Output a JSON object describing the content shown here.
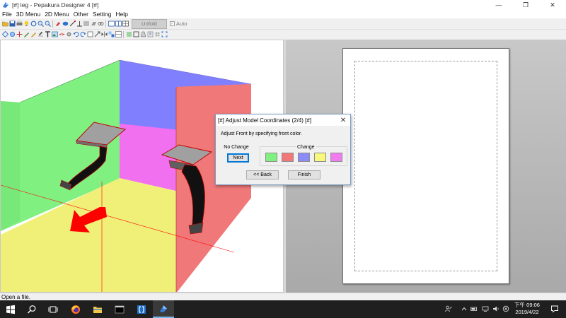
{
  "window": {
    "title": "[#] leg - Pepakura Designer 4 [#]",
    "controls": {
      "minimize": "—",
      "maximize": "❐",
      "close": "✕"
    }
  },
  "menu": [
    "File",
    "3D Menu",
    "2D Menu",
    "Other",
    "Setting",
    "Help"
  ],
  "toolbar": {
    "unfold_label": "Unfold",
    "auto_label": "Auto",
    "auto_checked": true
  },
  "dialog": {
    "title": "[#] Adjust Model Coordinates (2/4) [#]",
    "close": "✕",
    "message": "Adjust Front by specifying front color.",
    "no_change_label": "No Change",
    "next_label": "Next",
    "change_label": "Change",
    "swatches": [
      "#80f080",
      "#f07878",
      "#8c8cf8",
      "#f8f87c",
      "#f07cf0"
    ],
    "back_label": "<< Back",
    "finish_label": "Finish"
  },
  "cube_colors": {
    "left": "#80f080",
    "back": "#3f7fbf",
    "back_right": "#8080ff",
    "right": "#f07878",
    "floor": "#f0f078",
    "magenta": "#f070f0",
    "arrow": "#ff0000"
  },
  "status": {
    "text": "Open a file."
  },
  "taskbar": {
    "time": "下午 09:06",
    "date": "2019/4/22"
  }
}
